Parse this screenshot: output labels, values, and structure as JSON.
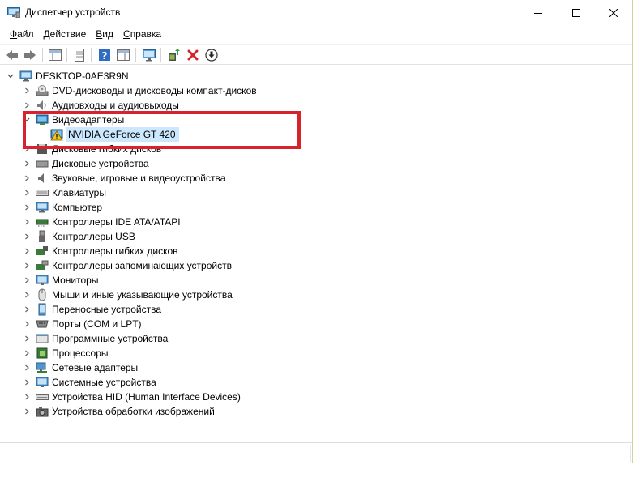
{
  "window": {
    "title": "Диспетчер устройств",
    "controls": {
      "minimize": "minimize-icon",
      "maximize": "maximize-icon",
      "close": "close-icon"
    }
  },
  "menu": [
    {
      "label": "Файл",
      "accel": "Ф",
      "rest": "айл"
    },
    {
      "label": "Действие",
      "accel": "Д",
      "rest": "ействие"
    },
    {
      "label": "Вид",
      "accel": "В",
      "rest": "ид"
    },
    {
      "label": "Справка",
      "accel": "С",
      "rest": "правка"
    }
  ],
  "toolbar": [
    "back-arrow-icon",
    "forward-arrow-icon",
    "console-tree-icon",
    "properties-icon",
    "help-icon",
    "show-hide-icon",
    "monitor-scan-icon",
    "update-driver-icon",
    "uninstall-x-icon",
    "download-icon"
  ],
  "colors": {
    "highlight_border": "#d7232e",
    "selection": "#cce8ff",
    "warning": "#f5c518"
  },
  "tree": {
    "root": "DESKTOP-0AE3R9N",
    "items": [
      {
        "label": "DVD-дисководы и дисководы компакт-дисков",
        "icon": "dvd-drive-icon"
      },
      {
        "label": "Аудиовходы и аудиовыходы",
        "icon": "speaker-icon"
      },
      {
        "label": "Видеоадаптеры",
        "icon": "display-adapter-icon",
        "expanded": true,
        "children": [
          {
            "label": "NVIDIA GeForce GT 420",
            "icon": "display-adapter-warning-icon",
            "selected": true
          }
        ]
      },
      {
        "label": "Дисковые гибких дисков",
        "icon": "floppy-icon"
      },
      {
        "label": "Дисковые устройства",
        "icon": "disk-drive-icon"
      },
      {
        "label": "Звуковые, игровые и видеоустройства",
        "icon": "sound-icon"
      },
      {
        "label": "Клавиатуры",
        "icon": "keyboard-icon"
      },
      {
        "label": "Компьютер",
        "icon": "computer-icon"
      },
      {
        "label": "Контроллеры IDE ATA/ATAPI",
        "icon": "ide-controller-icon"
      },
      {
        "label": "Контроллеры USB",
        "icon": "usb-icon"
      },
      {
        "label": "Контроллеры гибких дисков",
        "icon": "floppy-controller-icon"
      },
      {
        "label": "Контроллеры запоминающих устройств",
        "icon": "storage-controller-icon"
      },
      {
        "label": "Мониторы",
        "icon": "monitor-icon"
      },
      {
        "label": "Мыши и иные указывающие устройства",
        "icon": "mouse-icon"
      },
      {
        "label": "Переносные устройства",
        "icon": "portable-device-icon"
      },
      {
        "label": "Порты (COM и LPT)",
        "icon": "port-icon"
      },
      {
        "label": "Программные устройства",
        "icon": "software-device-icon"
      },
      {
        "label": "Процессоры",
        "icon": "processor-icon"
      },
      {
        "label": "Сетевые адаптеры",
        "icon": "network-adapter-icon"
      },
      {
        "label": "Системные устройства",
        "icon": "system-device-icon"
      },
      {
        "label": "Устройства HID (Human Interface Devices)",
        "icon": "hid-icon"
      },
      {
        "label": "Устройства обработки изображений",
        "icon": "imaging-device-icon"
      }
    ]
  }
}
